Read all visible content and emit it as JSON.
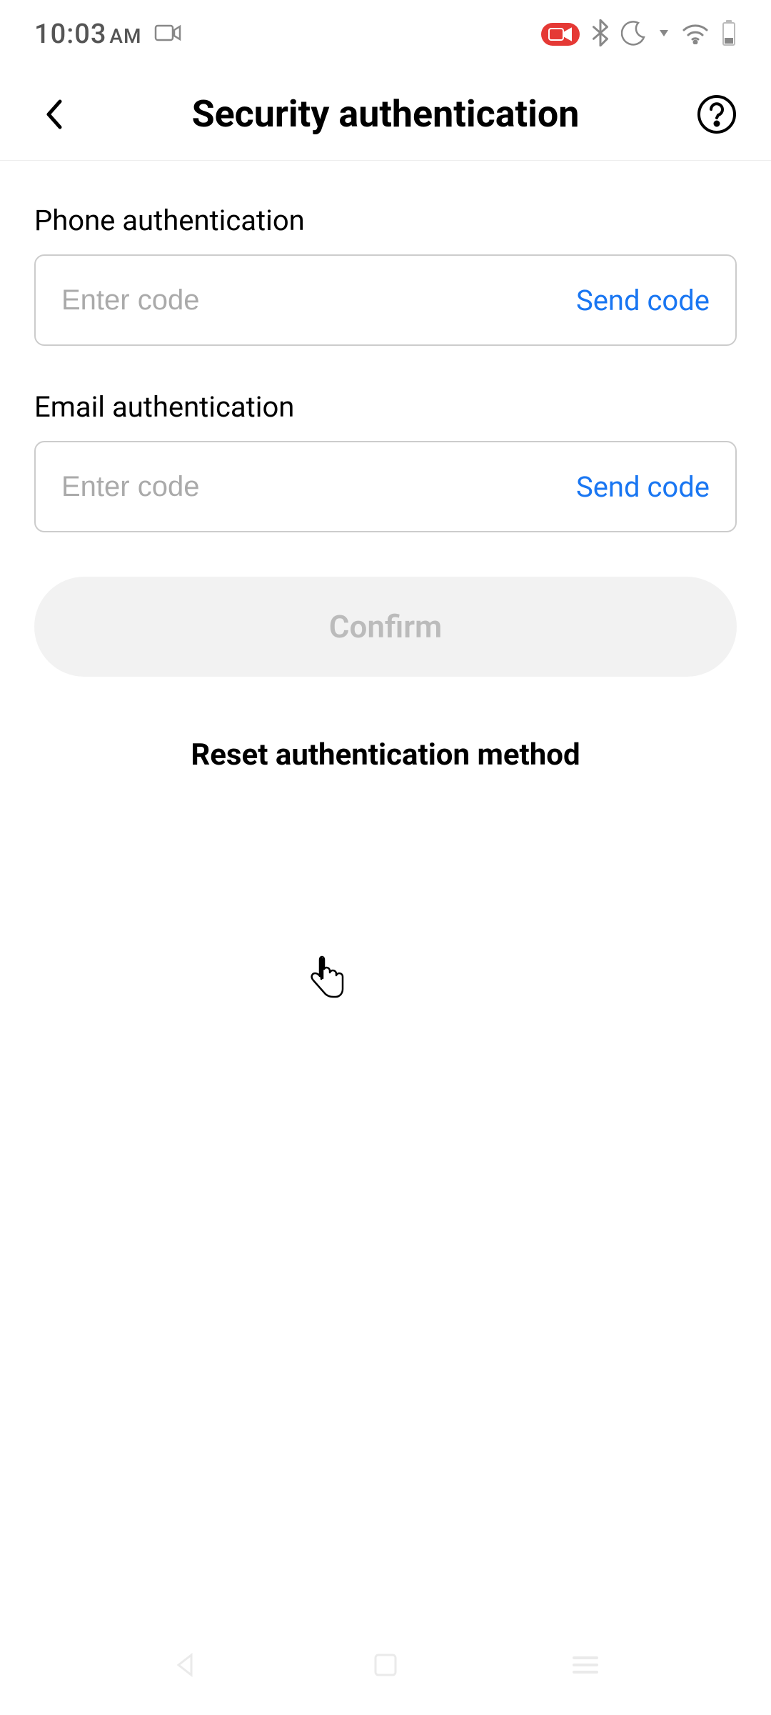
{
  "status_bar": {
    "time": "10:03",
    "ampm": "AM"
  },
  "header": {
    "title": "Security authentication"
  },
  "phone_auth": {
    "label": "Phone authentication",
    "placeholder": "Enter code",
    "send_label": "Send code"
  },
  "email_auth": {
    "label": "Email authentication",
    "placeholder": "Enter code",
    "send_label": "Send code"
  },
  "confirm_label": "Confirm",
  "reset_label": "Reset authentication method"
}
